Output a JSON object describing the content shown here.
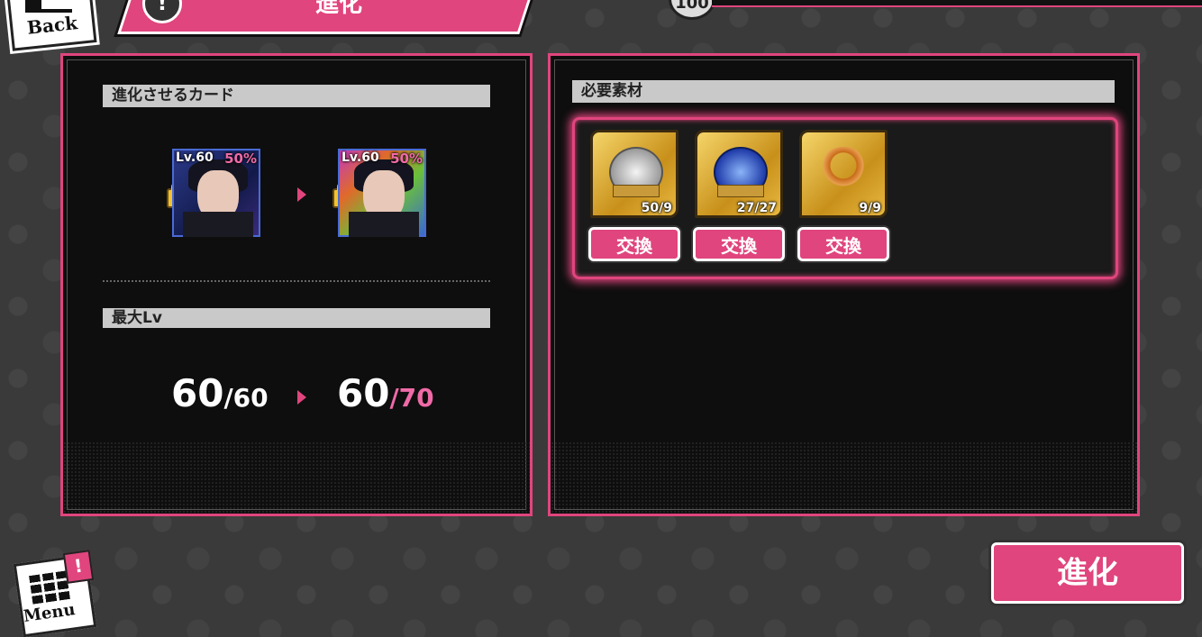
{
  "header": {
    "back_label": "Back",
    "title": "進化",
    "info_symbol": "!",
    "coin_value": "100"
  },
  "left_panel": {
    "card_section_title": "進化させるカード",
    "card_before": {
      "level": "Lv.60",
      "percent": "50%"
    },
    "card_after": {
      "level": "Lv.60",
      "percent": "50%"
    },
    "max_lv_title": "最大Lv",
    "max_lv_before": {
      "current": "60",
      "max": "/60"
    },
    "max_lv_after": {
      "current": "60",
      "max": "/70"
    }
  },
  "right_panel": {
    "materials_title": "必要素材",
    "materials": [
      {
        "name": "silver-emblem-gold",
        "count": "50/9",
        "exchange_label": "交換"
      },
      {
        "name": "blue-emblem-gold",
        "count": "27/27",
        "exchange_label": "交換"
      },
      {
        "name": "gold-headphones",
        "count": "9/9",
        "exchange_label": "交換"
      }
    ]
  },
  "footer": {
    "evolve_label": "進化",
    "menu_label": "Menu",
    "menu_badge": "!"
  },
  "colors": {
    "accent": "#e0457d",
    "panel_bg": "#0e0e0e",
    "header_gray": "#c9c9c9",
    "gold": "#e8b840"
  }
}
